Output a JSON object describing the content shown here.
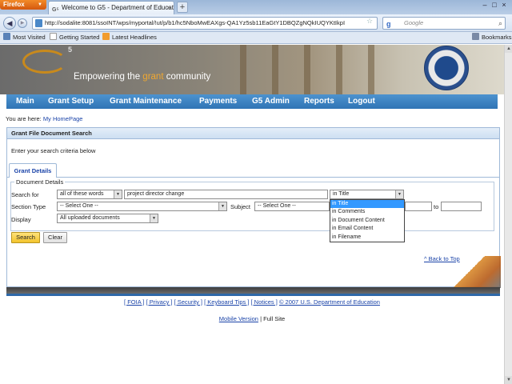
{
  "browser": {
    "app_button": "Firefox",
    "tab_title": "Welcome to G5 - Department of Educatio...",
    "url": "http://sodalite:8081/ssoINT/wps/myportal/!ut/p/b1/hc5NboMwEAXgs-QA1Yz5sb11EaGtY1DBQZgNQkIUQYKtIkpI",
    "search_placeholder": "Google",
    "bookmarks": [
      "Most Visited",
      "Getting Started",
      "Latest Headlines"
    ],
    "bookmarks_menu": "Bookmarks"
  },
  "banner": {
    "logo_sup": "5",
    "tagline_pre": "Empowering the ",
    "tagline_highlight": "grant",
    "tagline_post": " community"
  },
  "menu": [
    "Main",
    "Grant Setup",
    "Grant Maintenance",
    "Payments",
    "G5 Admin",
    "Reports",
    "Logout"
  ],
  "breadcrumb": {
    "prefix": "You are here:",
    "link": "My HomePage"
  },
  "panel": {
    "title": "Grant File Document Search",
    "instructions": "Enter your search criteria below",
    "tab": "Grant Details",
    "legend": "Document Details"
  },
  "form": {
    "search_for_label": "Search for",
    "match_mode": "all of these words",
    "search_text": "project director change",
    "scope_selected": "in Title",
    "scope_options": [
      "in Title",
      "in Comments",
      "in Document Content",
      "in Email Content",
      "in Filename"
    ],
    "section_type_label": "Section Type",
    "section_type_value": "-- Select One --",
    "subject_label": "Subject",
    "subject_value": "-- Select One --",
    "to_label": "to",
    "display_label": "Display",
    "display_value": "All uploaded documents",
    "search_button": "Search",
    "clear_button": "Clear"
  },
  "footer": {
    "back_to_top": "^ Back to Top",
    "links": [
      "[ FOIA ]",
      "[ Privacy ]",
      "[ Security ]",
      "[ Keyboard Tips ]",
      "[ Notices ]",
      "© 2007 U.S. Department of Education"
    ],
    "mobile_link": "Mobile Version",
    "full_site": "| Full Site"
  },
  "colors": {
    "menu_blue": "#2f74b5",
    "link_blue": "#1a43a8",
    "accent_orange": "#f0a830",
    "search_button": "#f2c32c",
    "selected_option": "#3399ff"
  }
}
